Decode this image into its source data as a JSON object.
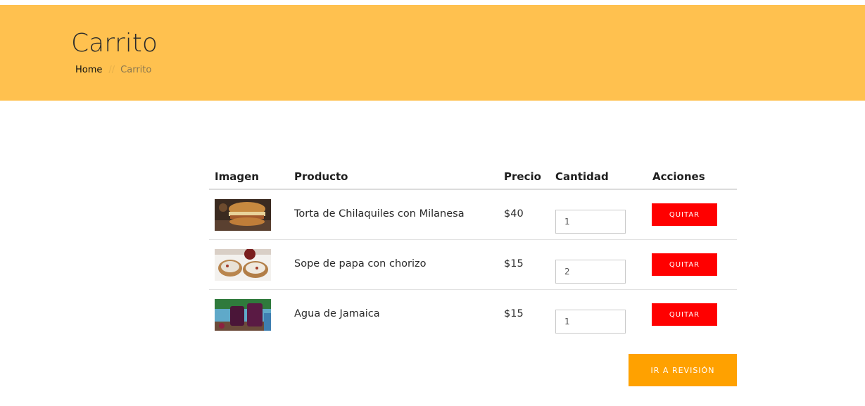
{
  "header": {
    "title": "Carrito",
    "breadcrumb": {
      "home": "Home",
      "separator": "//",
      "current": "Carrito"
    }
  },
  "table": {
    "columns": [
      "Imagen",
      "Producto",
      "Precio",
      "Cantidad",
      "Acciones"
    ],
    "rows": [
      {
        "image": "torta-photo",
        "product": "Torta de Chilaquiles con Milanesa",
        "price": "$40",
        "quantity": "1",
        "action": "QUITAR"
      },
      {
        "image": "sope-photo",
        "product": "Sope de papa con chorizo",
        "price": "$15",
        "quantity": "2",
        "action": "QUITAR"
      },
      {
        "image": "jamaica-photo",
        "product": "Agua de Jamaica",
        "price": "$15",
        "quantity": "1",
        "action": "QUITAR"
      }
    ]
  },
  "checkout_label": "IR A REVISIÓN",
  "colors": {
    "hero": "#ffc14f",
    "remove": "#ff0000",
    "checkout": "#ffa100"
  }
}
